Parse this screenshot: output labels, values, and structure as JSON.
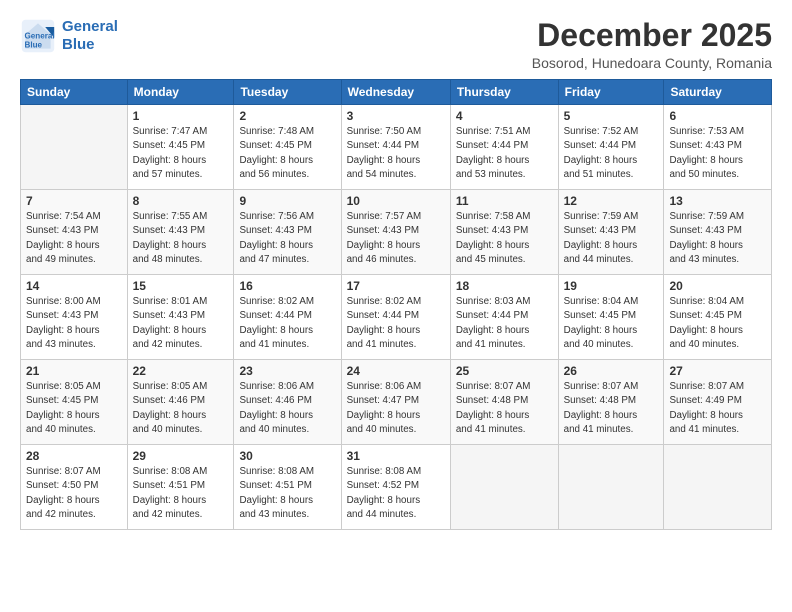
{
  "logo": {
    "line1": "General",
    "line2": "Blue"
  },
  "title": "December 2025",
  "subtitle": "Bosorod, Hunedoara County, Romania",
  "weekdays": [
    "Sunday",
    "Monday",
    "Tuesday",
    "Wednesday",
    "Thursday",
    "Friday",
    "Saturday"
  ],
  "weeks": [
    [
      {
        "day": "",
        "info": ""
      },
      {
        "day": "1",
        "info": "Sunrise: 7:47 AM\nSunset: 4:45 PM\nDaylight: 8 hours\nand 57 minutes."
      },
      {
        "day": "2",
        "info": "Sunrise: 7:48 AM\nSunset: 4:45 PM\nDaylight: 8 hours\nand 56 minutes."
      },
      {
        "day": "3",
        "info": "Sunrise: 7:50 AM\nSunset: 4:44 PM\nDaylight: 8 hours\nand 54 minutes."
      },
      {
        "day": "4",
        "info": "Sunrise: 7:51 AM\nSunset: 4:44 PM\nDaylight: 8 hours\nand 53 minutes."
      },
      {
        "day": "5",
        "info": "Sunrise: 7:52 AM\nSunset: 4:44 PM\nDaylight: 8 hours\nand 51 minutes."
      },
      {
        "day": "6",
        "info": "Sunrise: 7:53 AM\nSunset: 4:43 PM\nDaylight: 8 hours\nand 50 minutes."
      }
    ],
    [
      {
        "day": "7",
        "info": "Sunrise: 7:54 AM\nSunset: 4:43 PM\nDaylight: 8 hours\nand 49 minutes."
      },
      {
        "day": "8",
        "info": "Sunrise: 7:55 AM\nSunset: 4:43 PM\nDaylight: 8 hours\nand 48 minutes."
      },
      {
        "day": "9",
        "info": "Sunrise: 7:56 AM\nSunset: 4:43 PM\nDaylight: 8 hours\nand 47 minutes."
      },
      {
        "day": "10",
        "info": "Sunrise: 7:57 AM\nSunset: 4:43 PM\nDaylight: 8 hours\nand 46 minutes."
      },
      {
        "day": "11",
        "info": "Sunrise: 7:58 AM\nSunset: 4:43 PM\nDaylight: 8 hours\nand 45 minutes."
      },
      {
        "day": "12",
        "info": "Sunrise: 7:59 AM\nSunset: 4:43 PM\nDaylight: 8 hours\nand 44 minutes."
      },
      {
        "day": "13",
        "info": "Sunrise: 7:59 AM\nSunset: 4:43 PM\nDaylight: 8 hours\nand 43 minutes."
      }
    ],
    [
      {
        "day": "14",
        "info": "Sunrise: 8:00 AM\nSunset: 4:43 PM\nDaylight: 8 hours\nand 43 minutes."
      },
      {
        "day": "15",
        "info": "Sunrise: 8:01 AM\nSunset: 4:43 PM\nDaylight: 8 hours\nand 42 minutes."
      },
      {
        "day": "16",
        "info": "Sunrise: 8:02 AM\nSunset: 4:44 PM\nDaylight: 8 hours\nand 41 minutes."
      },
      {
        "day": "17",
        "info": "Sunrise: 8:02 AM\nSunset: 4:44 PM\nDaylight: 8 hours\nand 41 minutes."
      },
      {
        "day": "18",
        "info": "Sunrise: 8:03 AM\nSunset: 4:44 PM\nDaylight: 8 hours\nand 41 minutes."
      },
      {
        "day": "19",
        "info": "Sunrise: 8:04 AM\nSunset: 4:45 PM\nDaylight: 8 hours\nand 40 minutes."
      },
      {
        "day": "20",
        "info": "Sunrise: 8:04 AM\nSunset: 4:45 PM\nDaylight: 8 hours\nand 40 minutes."
      }
    ],
    [
      {
        "day": "21",
        "info": "Sunrise: 8:05 AM\nSunset: 4:45 PM\nDaylight: 8 hours\nand 40 minutes."
      },
      {
        "day": "22",
        "info": "Sunrise: 8:05 AM\nSunset: 4:46 PM\nDaylight: 8 hours\nand 40 minutes."
      },
      {
        "day": "23",
        "info": "Sunrise: 8:06 AM\nSunset: 4:46 PM\nDaylight: 8 hours\nand 40 minutes."
      },
      {
        "day": "24",
        "info": "Sunrise: 8:06 AM\nSunset: 4:47 PM\nDaylight: 8 hours\nand 40 minutes."
      },
      {
        "day": "25",
        "info": "Sunrise: 8:07 AM\nSunset: 4:48 PM\nDaylight: 8 hours\nand 41 minutes."
      },
      {
        "day": "26",
        "info": "Sunrise: 8:07 AM\nSunset: 4:48 PM\nDaylight: 8 hours\nand 41 minutes."
      },
      {
        "day": "27",
        "info": "Sunrise: 8:07 AM\nSunset: 4:49 PM\nDaylight: 8 hours\nand 41 minutes."
      }
    ],
    [
      {
        "day": "28",
        "info": "Sunrise: 8:07 AM\nSunset: 4:50 PM\nDaylight: 8 hours\nand 42 minutes."
      },
      {
        "day": "29",
        "info": "Sunrise: 8:08 AM\nSunset: 4:51 PM\nDaylight: 8 hours\nand 42 minutes."
      },
      {
        "day": "30",
        "info": "Sunrise: 8:08 AM\nSunset: 4:51 PM\nDaylight: 8 hours\nand 43 minutes."
      },
      {
        "day": "31",
        "info": "Sunrise: 8:08 AM\nSunset: 4:52 PM\nDaylight: 8 hours\nand 44 minutes."
      },
      {
        "day": "",
        "info": ""
      },
      {
        "day": "",
        "info": ""
      },
      {
        "day": "",
        "info": ""
      }
    ]
  ]
}
